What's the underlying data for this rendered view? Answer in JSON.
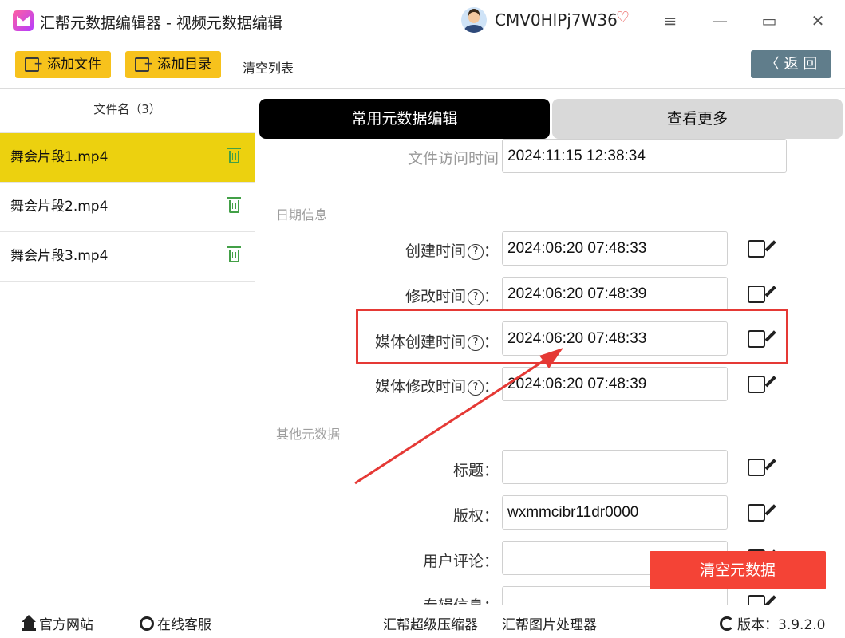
{
  "titlebar": {
    "app_title": "汇帮元数据编辑器 - 视频元数据编辑",
    "username": "CMV0HlPj7W36",
    "menu_glyph": "≡",
    "minimize_glyph": "—",
    "maximize_glyph": "▭",
    "close_glyph": "✕"
  },
  "toolbar": {
    "add_file": "添加文件",
    "add_dir": "添加目录",
    "clear_list": "清空列表",
    "back": "〈  返 回"
  },
  "file_list": {
    "header": "文件名（3）",
    "items": [
      {
        "name": "舞会片段1.mp4",
        "active": true
      },
      {
        "name": "舞会片段2.mp4",
        "active": false
      },
      {
        "name": "舞会片段3.mp4",
        "active": false
      }
    ]
  },
  "tabs": {
    "common": "常用元数据编辑",
    "more": "查看更多"
  },
  "fields": {
    "access_time": {
      "label": "文件访问时间",
      "value": "2024:11:15 12:38:34"
    },
    "date_section": "日期信息",
    "create_time": {
      "label": "创建时间",
      "value": "2024:06:20 07:48:33"
    },
    "modify_time": {
      "label": "修改时间",
      "value": "2024:06:20 07:48:39"
    },
    "media_create_time": {
      "label": "媒体创建时间",
      "value": "2024:06:20 07:48:33"
    },
    "media_modify_time": {
      "label": "媒体修改时间",
      "value": "2024:06:20 07:48:39"
    },
    "other_section": "其他元数据",
    "title": {
      "label": "标题：",
      "value": ""
    },
    "copyright": {
      "label": "版权：",
      "value": "wxmmcibr11dr0000"
    },
    "comment": {
      "label": "用户评论：",
      "value": ""
    },
    "album": {
      "label": "专辑信息：",
      "value": ""
    }
  },
  "help_glyph": "?",
  "colon": "：",
  "clear_metadata": "清空元数据",
  "footer": {
    "official_site": "官方网站",
    "online_service": "在线客服",
    "compressor": "汇帮超级压缩器",
    "image_tool": "汇帮图片处理器",
    "version_label": "版本：",
    "version": "3.9.2.0"
  },
  "colors": {
    "accent_yellow": "#f7c21c",
    "active_row": "#ecd10f",
    "danger": "#f44336",
    "back_button": "#607d8b"
  }
}
